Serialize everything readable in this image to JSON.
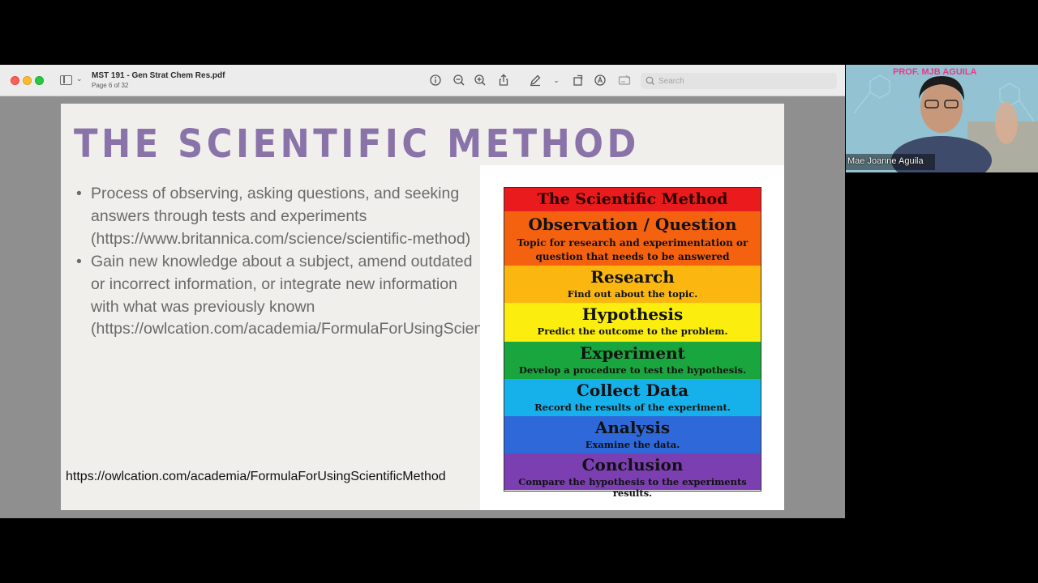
{
  "window": {
    "title": "MST 191 - Gen Strat Chem Res.pdf",
    "page_indicator": "Page 6 of 32",
    "search_placeholder": "Search"
  },
  "toolbar_icons": [
    "info-icon",
    "zoom-out-icon",
    "zoom-in-icon",
    "share-icon",
    "markup-pen-icon",
    "chevron-down-icon",
    "rotate-icon",
    "annotate-icon",
    "form-icon",
    "search-icon"
  ],
  "slide": {
    "title": "THE SCIENTIFIC METHOD",
    "bullets": [
      "Process of observing, asking questions, and seeking answers through tests and experiments (https://www.britannica.com/science/scientific-method)",
      "Gain new knowledge about a subject, amend outdated or incorrect information, or integrate new information with what was previously known (https://owlcation.com/academia/FormulaForUsingScientificMethod)"
    ],
    "source_url": "https://owlcation.com/academia/FormulaForUsingScientificMethod"
  },
  "method_chart": {
    "title": "The Scientific Method",
    "steps": [
      {
        "name": "Observation / Question",
        "desc": "Topic for research and experimentation or question that needs to be answered",
        "color": "#f5620f"
      },
      {
        "name": "Research",
        "desc": "Find out about the topic.",
        "color": "#fbb710"
      },
      {
        "name": "Hypothesis",
        "desc": "Predict the outcome to the problem.",
        "color": "#fbee0f"
      },
      {
        "name": "Experiment",
        "desc": "Develop a procedure to test the hypothesis.",
        "color": "#1aa63e"
      },
      {
        "name": "Collect Data",
        "desc": "Record the results of the experiment.",
        "color": "#16b1ea"
      },
      {
        "name": "Analysis",
        "desc": "Examine the data.",
        "color": "#2f68d8"
      },
      {
        "name": "Conclusion",
        "desc": "Compare the hypothesis to the experiments results.",
        "color": "#7b3fb1"
      }
    ]
  },
  "webcam": {
    "banner": "PROF. MJB AGUILA",
    "participant_name": "Mae Joanne Aguila"
  }
}
